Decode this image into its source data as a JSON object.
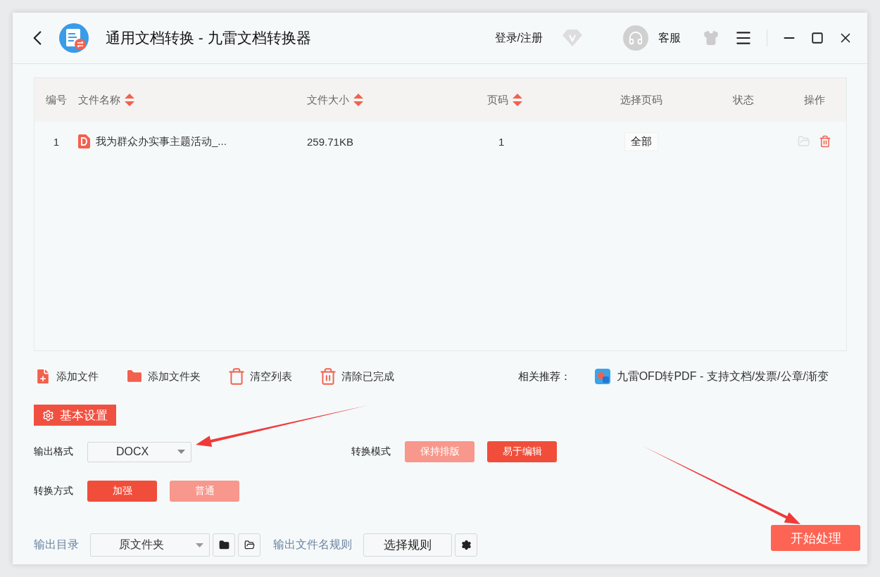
{
  "window": {
    "title": "通用文档转换 - 九雷文档转换器",
    "login": "登录/注册",
    "service": "客服"
  },
  "table": {
    "columns": [
      {
        "label": "编号",
        "sortable": false
      },
      {
        "label": "文件名称",
        "sortable": true
      },
      {
        "label": "文件大小",
        "sortable": true
      },
      {
        "label": "页码",
        "sortable": true
      },
      {
        "label": "选择页码",
        "sortable": false
      },
      {
        "label": "状态",
        "sortable": false
      },
      {
        "label": "操作",
        "sortable": false
      }
    ],
    "rows": [
      {
        "index": "1",
        "name": "我为群众办实事主题活动_...",
        "size": "259.71KB",
        "pages": "1",
        "page_select": "全部"
      }
    ]
  },
  "toolbar": [
    {
      "kind": "add-file",
      "label": "添加文件"
    },
    {
      "kind": "add-folder",
      "label": "添加文件夹"
    },
    {
      "kind": "clear-list",
      "label": "清空列表"
    },
    {
      "kind": "clear-done",
      "label": "清除已完成"
    }
  ],
  "recommend": {
    "label": "相关推荐：",
    "text": "九雷OFD转PDF - 支持文档/发票/公章/渐变"
  },
  "settings": {
    "title": "基本设置",
    "output_format": {
      "label": "输出格式",
      "value": "DOCX"
    },
    "convert_mode": {
      "label": "转换模式",
      "options": [
        {
          "label": "保持排版",
          "selected": false
        },
        {
          "label": "易于编辑",
          "selected": true
        }
      ]
    },
    "convert_method": {
      "label": "转换方式",
      "options": [
        {
          "label": "加强",
          "selected": true
        },
        {
          "label": "普通",
          "selected": false
        }
      ]
    }
  },
  "output": {
    "dir_label": "输出目录",
    "dir_value": "原文件夹",
    "rule_label": "输出文件名规则",
    "rule_button": "选择规则",
    "start_button": "开始处理"
  }
}
